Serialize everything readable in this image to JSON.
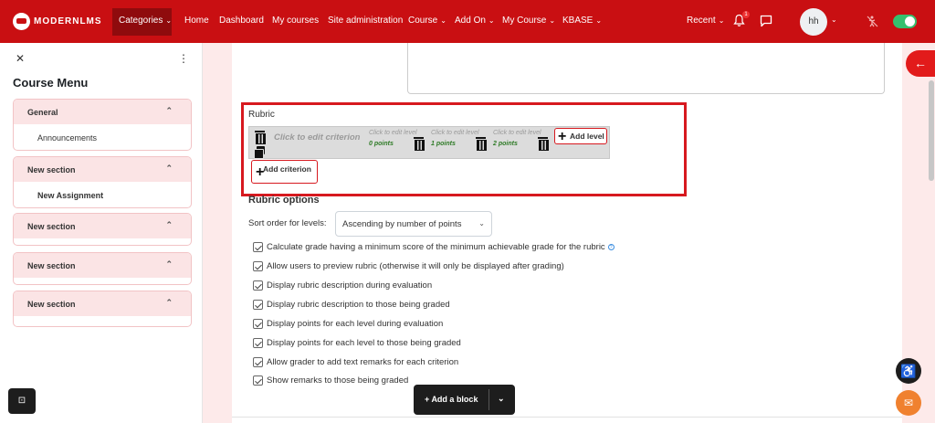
{
  "brand": {
    "logo_text": "MODERNLMS"
  },
  "nav": {
    "items": [
      {
        "label": "Categories",
        "caret": true
      },
      {
        "label": "Home",
        "caret": false
      },
      {
        "label": "Dashboard",
        "caret": false
      },
      {
        "label": "My courses",
        "caret": false
      },
      {
        "label": "Site administration",
        "caret": false
      },
      {
        "label": "Course",
        "caret": true
      },
      {
        "label": "Add On",
        "caret": true
      },
      {
        "label": "My Course",
        "caret": true
      },
      {
        "label": "KBASE",
        "caret": true
      }
    ],
    "recent": "Recent",
    "notification_count": "1",
    "avatar_initials": "hh"
  },
  "drawer": {
    "title": "Course Menu",
    "sections": [
      {
        "name": "General",
        "items": [
          "Announcements"
        ]
      },
      {
        "name": "New section",
        "items": [
          "New Assignment"
        ]
      },
      {
        "name": "New section",
        "items": []
      },
      {
        "name": "New section",
        "items": []
      },
      {
        "name": "New section",
        "items": []
      }
    ]
  },
  "rubric": {
    "label": "Rubric",
    "criterion_placeholder": "Click to edit criterion",
    "levels": [
      {
        "desc": "Click to edit level",
        "points": "0 points"
      },
      {
        "desc": "Click to edit level",
        "points": "1 points"
      },
      {
        "desc": "Click to edit level",
        "points": "2 points"
      }
    ],
    "add_level": "Add level",
    "add_criterion": "Add criterion"
  },
  "options": {
    "heading": "Rubric options",
    "sort_label": "Sort order for levels:",
    "sort_value": "Ascending by number of points",
    "checkboxes": [
      "Calculate grade having a minimum score of the minimum achievable grade for the rubric",
      "Allow users to preview rubric (otherwise it will only be displayed after grading)",
      "Display rubric description during evaluation",
      "Display rubric description to those being graded",
      "Display points for each level during evaluation",
      "Display points for each level to those being graded",
      "Allow grader to add text remarks for each criterion",
      "Show remarks to those being graded"
    ]
  },
  "footer": {
    "add_block": "Add a block"
  },
  "colors": {
    "brand": "#c90f12",
    "accent_border": "#d7191f",
    "points_green": "#2d7a25"
  }
}
